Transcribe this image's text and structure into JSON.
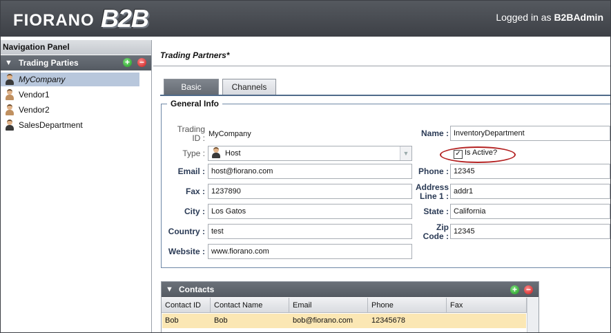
{
  "header": {
    "logo_text": "FIORANO",
    "logo_b2b": "B2B",
    "logged_in_prefix": "Logged in as ",
    "username": "B2BAdmin"
  },
  "nav": {
    "title": "Navigation Panel",
    "section_label": "Trading Parties",
    "items": [
      {
        "label": "MyCompany",
        "icon": "person-dark-icon",
        "selected": true
      },
      {
        "label": "Vendor1",
        "icon": "person-tan-icon",
        "selected": false
      },
      {
        "label": "Vendor2",
        "icon": "person-tan-icon",
        "selected": false
      },
      {
        "label": "SalesDepartment",
        "icon": "person-dark-icon",
        "selected": false
      }
    ]
  },
  "main": {
    "page_title": "Trading Partners*",
    "tabs": [
      {
        "label": "Basic",
        "active": true
      },
      {
        "label": "Channels",
        "active": false
      }
    ],
    "general_info": {
      "legend": "General Info",
      "trading_id_label_1": "Trading",
      "trading_id_label_2": "ID :",
      "trading_id_value": "MyCompany",
      "type_label": "Type :",
      "type_value": "Host",
      "email_label": "Email :",
      "email_value": "host@fiorano.com",
      "fax_label": "Fax :",
      "fax_value": "1237890",
      "city_label": "City :",
      "city_value": "Los Gatos",
      "country_label": "Country :",
      "country_value": "test",
      "website_label": "Website :",
      "website_value": "www.fiorano.com",
      "name_label": "Name :",
      "name_value": "InventoryDepartment",
      "is_active_label": "Is Active?",
      "is_active_checked": true,
      "phone_label": "Phone :",
      "phone_value": "12345",
      "address_label_1": "Address",
      "address_label_2": "Line 1 :",
      "address_value": "addr1",
      "state_label": "State :",
      "state_value": "California",
      "zip_label_1": "Zip",
      "zip_label_2": "Code :",
      "zip_value": "12345"
    },
    "contacts": {
      "title": "Contacts",
      "columns": [
        "Contact ID",
        "Contact Name",
        "Email",
        "Phone",
        "Fax"
      ],
      "rows": [
        [
          "Bob",
          "Bob",
          "bob@fiorano.com",
          "12345678",
          ""
        ]
      ]
    }
  },
  "colors": {
    "header_bg": "#4a4e54",
    "accent_blue": "#4f6a8a",
    "selected_row": "#fbe7b4",
    "selected_tree": "#b8c7dc",
    "highlight_ring": "#b42222"
  }
}
